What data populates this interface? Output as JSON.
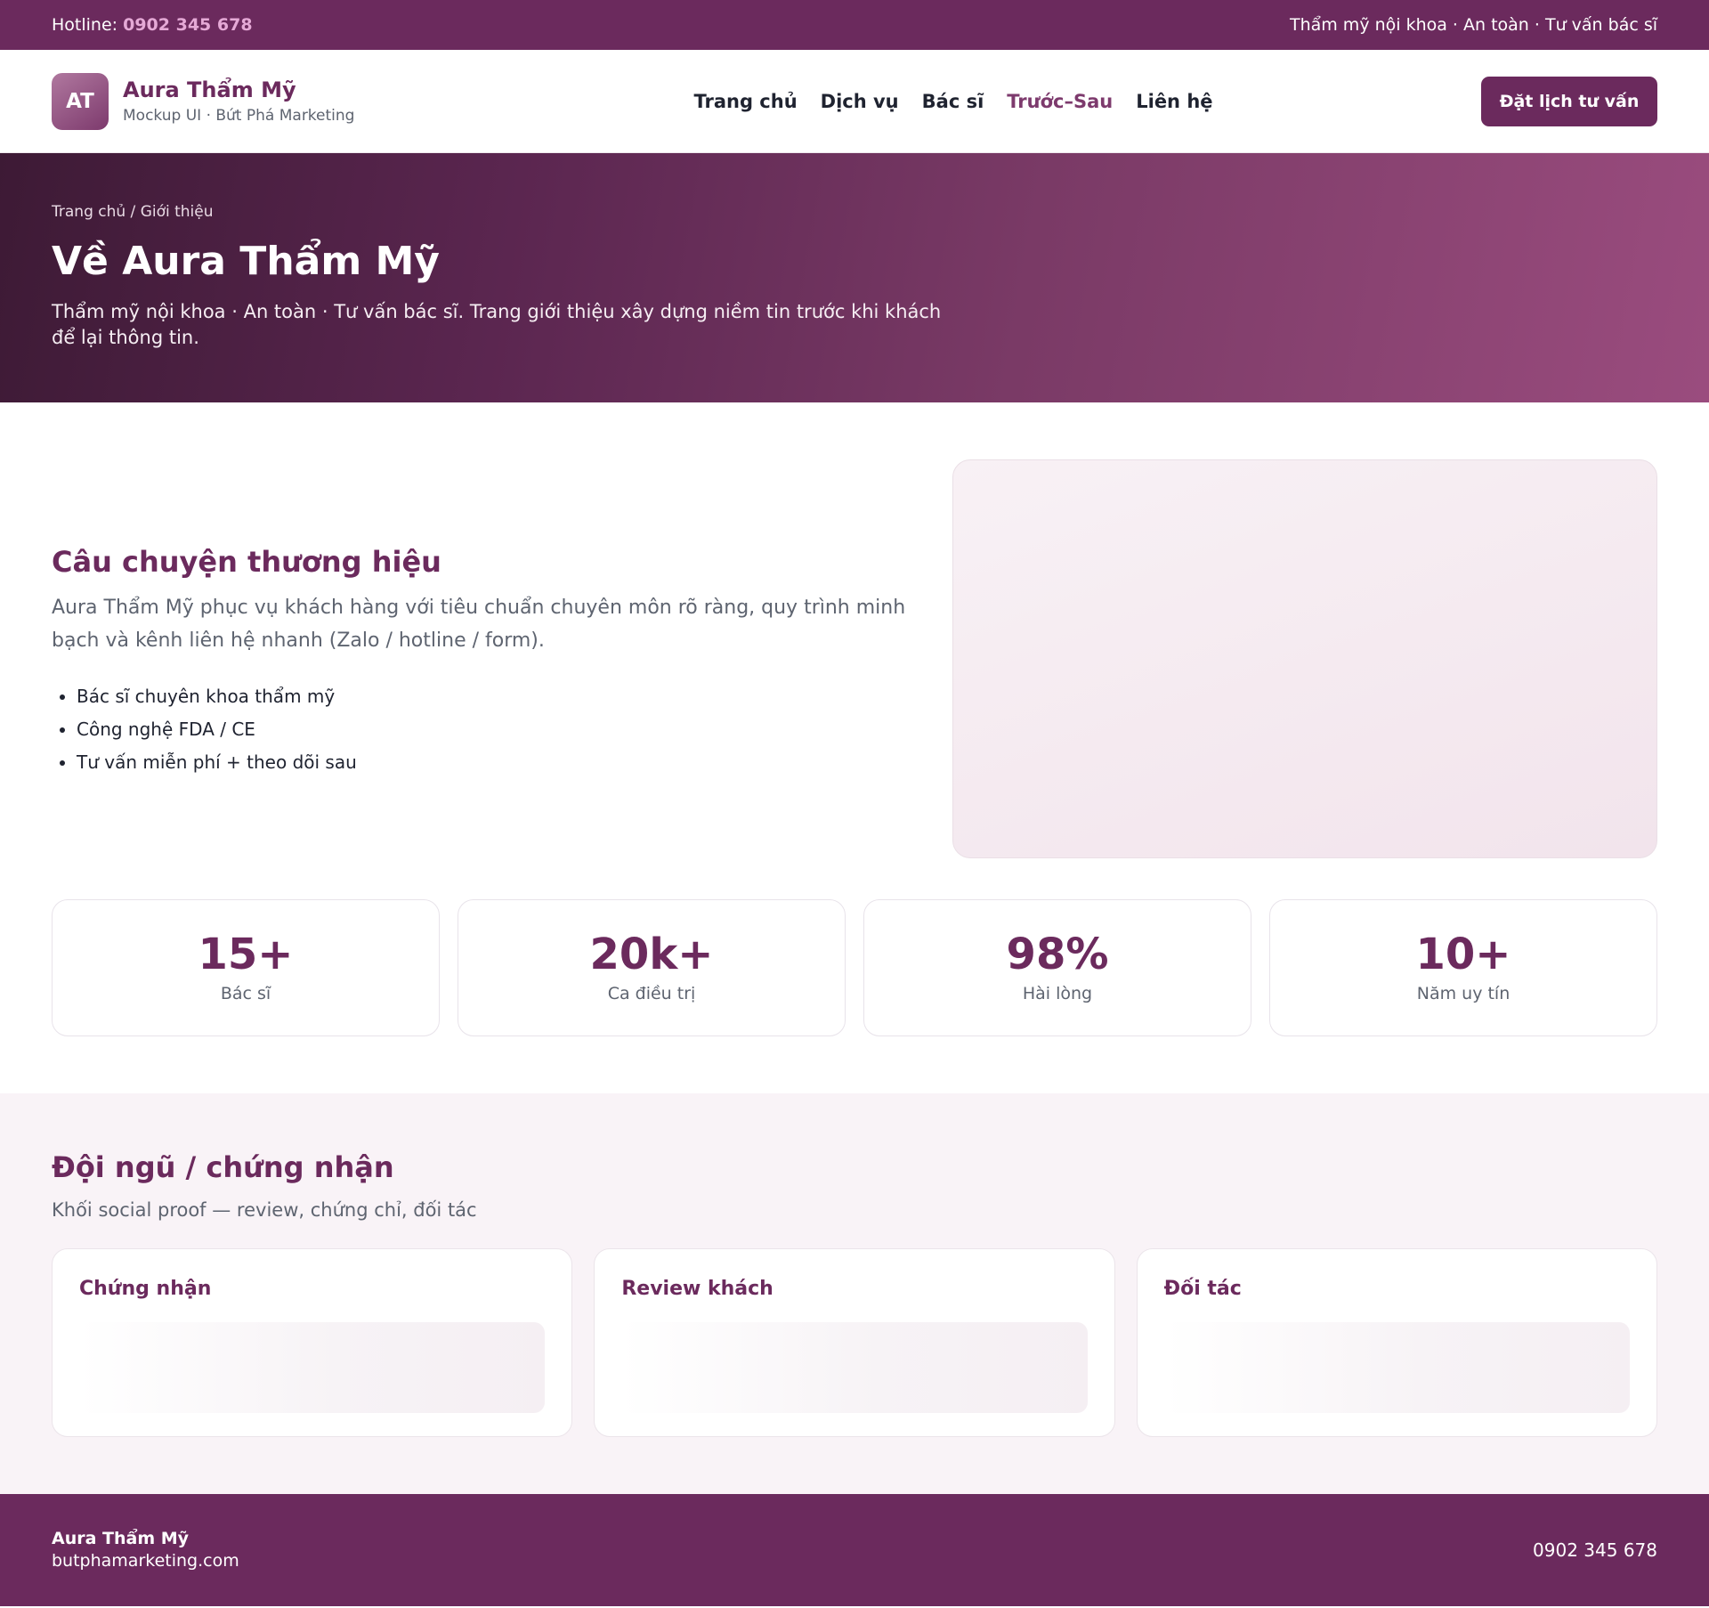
{
  "topbar": {
    "hotline_label": "Hotline:",
    "hotline_number": "0902 345 678",
    "tagline": "Thẩm mỹ nội khoa · An toàn · Tư vấn bác sĩ"
  },
  "header": {
    "logo_text": "AT",
    "brand_name": "Aura Thẩm Mỹ",
    "brand_sub": "Mockup UI · Bứt Phá Marketing",
    "nav": [
      {
        "label": "Trang chủ"
      },
      {
        "label": "Dịch vụ"
      },
      {
        "label": "Bác sĩ"
      },
      {
        "label": "Trước–Sau"
      },
      {
        "label": "Liên hệ"
      }
    ],
    "active_nav": "Trước–Sau",
    "cta_label": "Đặt lịch tư vấn"
  },
  "hero": {
    "breadcrumb": "Trang chủ / Giới thiệu",
    "title": "Về Aura Thẩm Mỹ",
    "description": "Thẩm mỹ nội khoa · An toàn · Tư vấn bác sĩ. Trang giới thiệu xây dựng niềm tin trước khi khách để lại thông tin."
  },
  "story": {
    "title": "Câu chuyện thương hiệu",
    "description": "Aura Thẩm Mỹ phục vụ khách hàng với tiêu chuẩn chuyên môn rõ ràng, quy trình minh bạch và kênh liên hệ nhanh (Zalo / hotline / form).",
    "bullets": [
      "Bác sĩ chuyên khoa thẩm mỹ",
      "Công nghệ FDA / CE",
      "Tư vấn miễn phí + theo dõi sau"
    ]
  },
  "stats": [
    {
      "value": "15+",
      "label": "Bác sĩ"
    },
    {
      "value": "20k+",
      "label": "Ca điều trị"
    },
    {
      "value": "98%",
      "label": "Hài lòng"
    },
    {
      "value": "10+",
      "label": "Năm uy tín"
    }
  ],
  "team": {
    "title": "Đội ngũ / chứng nhận",
    "subtitle": "Khối social proof — review, chứng chỉ, đối tác",
    "cards": [
      {
        "title": "Chứng nhận"
      },
      {
        "title": "Review khách"
      },
      {
        "title": "Đối tác"
      }
    ]
  },
  "footer": {
    "brand": "Aura Thẩm Mỹ",
    "site": "butphamarketing.com",
    "phone": "0902 345 678"
  },
  "colors": {
    "brand": "#6b2a5d",
    "accent": "#e5a9d6"
  }
}
